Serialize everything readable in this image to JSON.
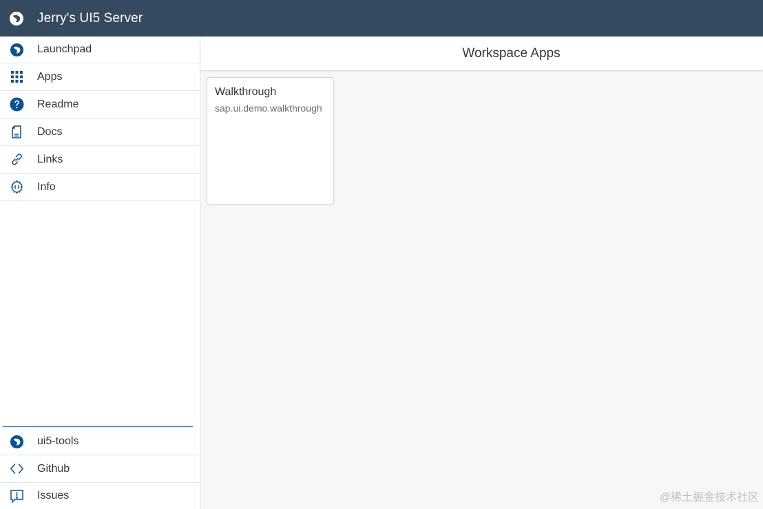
{
  "shell": {
    "title": "Jerry's UI5 Server",
    "bar_color": "#354a5f",
    "logo_icon": "ui5-logo-icon"
  },
  "sidebar": {
    "items": [
      {
        "label": "Launchpad",
        "icon": "ui5-logo-icon"
      },
      {
        "label": "Apps",
        "icon": "grid-icon"
      },
      {
        "label": "Readme",
        "icon": "question-icon"
      },
      {
        "label": "Docs",
        "icon": "document-icon"
      },
      {
        "label": "Links",
        "icon": "link-icon"
      },
      {
        "label": "Info",
        "icon": "settings-code-icon"
      }
    ],
    "bottom_items": [
      {
        "label": "ui5-tools",
        "icon": "ui5-logo-icon"
      },
      {
        "label": "Github",
        "icon": "code-brackets-icon"
      },
      {
        "label": "Issues",
        "icon": "feedback-icon"
      }
    ],
    "icon_color": "#0a5294"
  },
  "main": {
    "title": "Workspace Apps",
    "tiles": [
      {
        "title": "Walkthrough",
        "subtitle": "sap.ui.demo.walkthrough"
      }
    ]
  },
  "watermark": "@稀土掘金技术社区"
}
